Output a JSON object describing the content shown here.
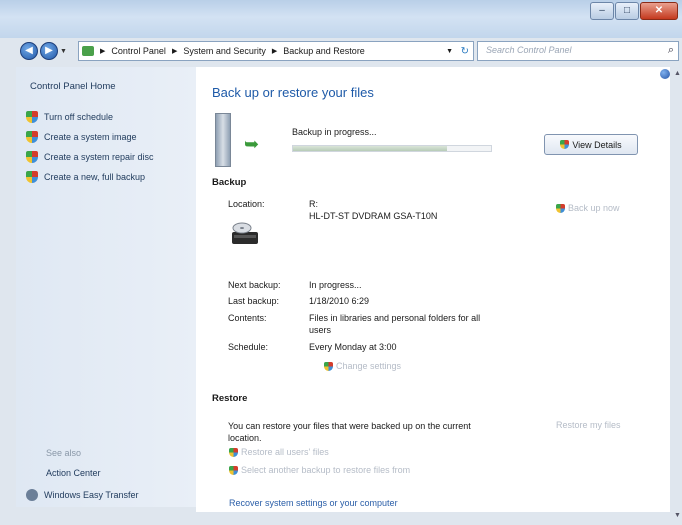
{
  "window": {
    "minimize_glyph": "–",
    "maximize_glyph": "□",
    "close_glyph": "✕"
  },
  "nav": {
    "breadcrumbs": [
      "Control Panel",
      "System and Security",
      "Backup and Restore"
    ],
    "search_placeholder": "Search Control Panel"
  },
  "sidebar": {
    "home": "Control Panel Home",
    "tasks": [
      "Turn off schedule",
      "Create a system image",
      "Create a system repair disc",
      "Create a new, full backup"
    ],
    "see_also_label": "See also",
    "see_also": [
      "Action Center",
      "Windows Easy Transfer"
    ]
  },
  "main": {
    "title": "Back up or restore your files",
    "progress_label": "Backup in progress...",
    "progress_fraction": 0.78,
    "view_details": "View Details",
    "backup_section": "Backup",
    "location_label": "Location:",
    "location_drive": "R:",
    "location_device": "HL-DT-ST DVDRAM GSA-T10N",
    "backup_now": "Back up now",
    "next_backup_label": "Next backup:",
    "next_backup_value": "In progress...",
    "last_backup_label": "Last backup:",
    "last_backup_value": "1/18/2010 6:29",
    "contents_label": "Contents:",
    "contents_value_line1": "Files in libraries and personal folders for all",
    "contents_value_line2": "users",
    "schedule_label": "Schedule:",
    "schedule_value": "Every Monday at 3:00",
    "change_settings": "Change settings",
    "restore_section": "Restore",
    "restore_message_line1": "You can restore your files that were backed up on the current",
    "restore_message_line2": "location.",
    "restore_my_files": "Restore my files",
    "restore_all_users": "Restore all users' files",
    "select_other_backup": "Select another backup to restore files from",
    "recover_settings": "Recover system settings or your computer"
  }
}
